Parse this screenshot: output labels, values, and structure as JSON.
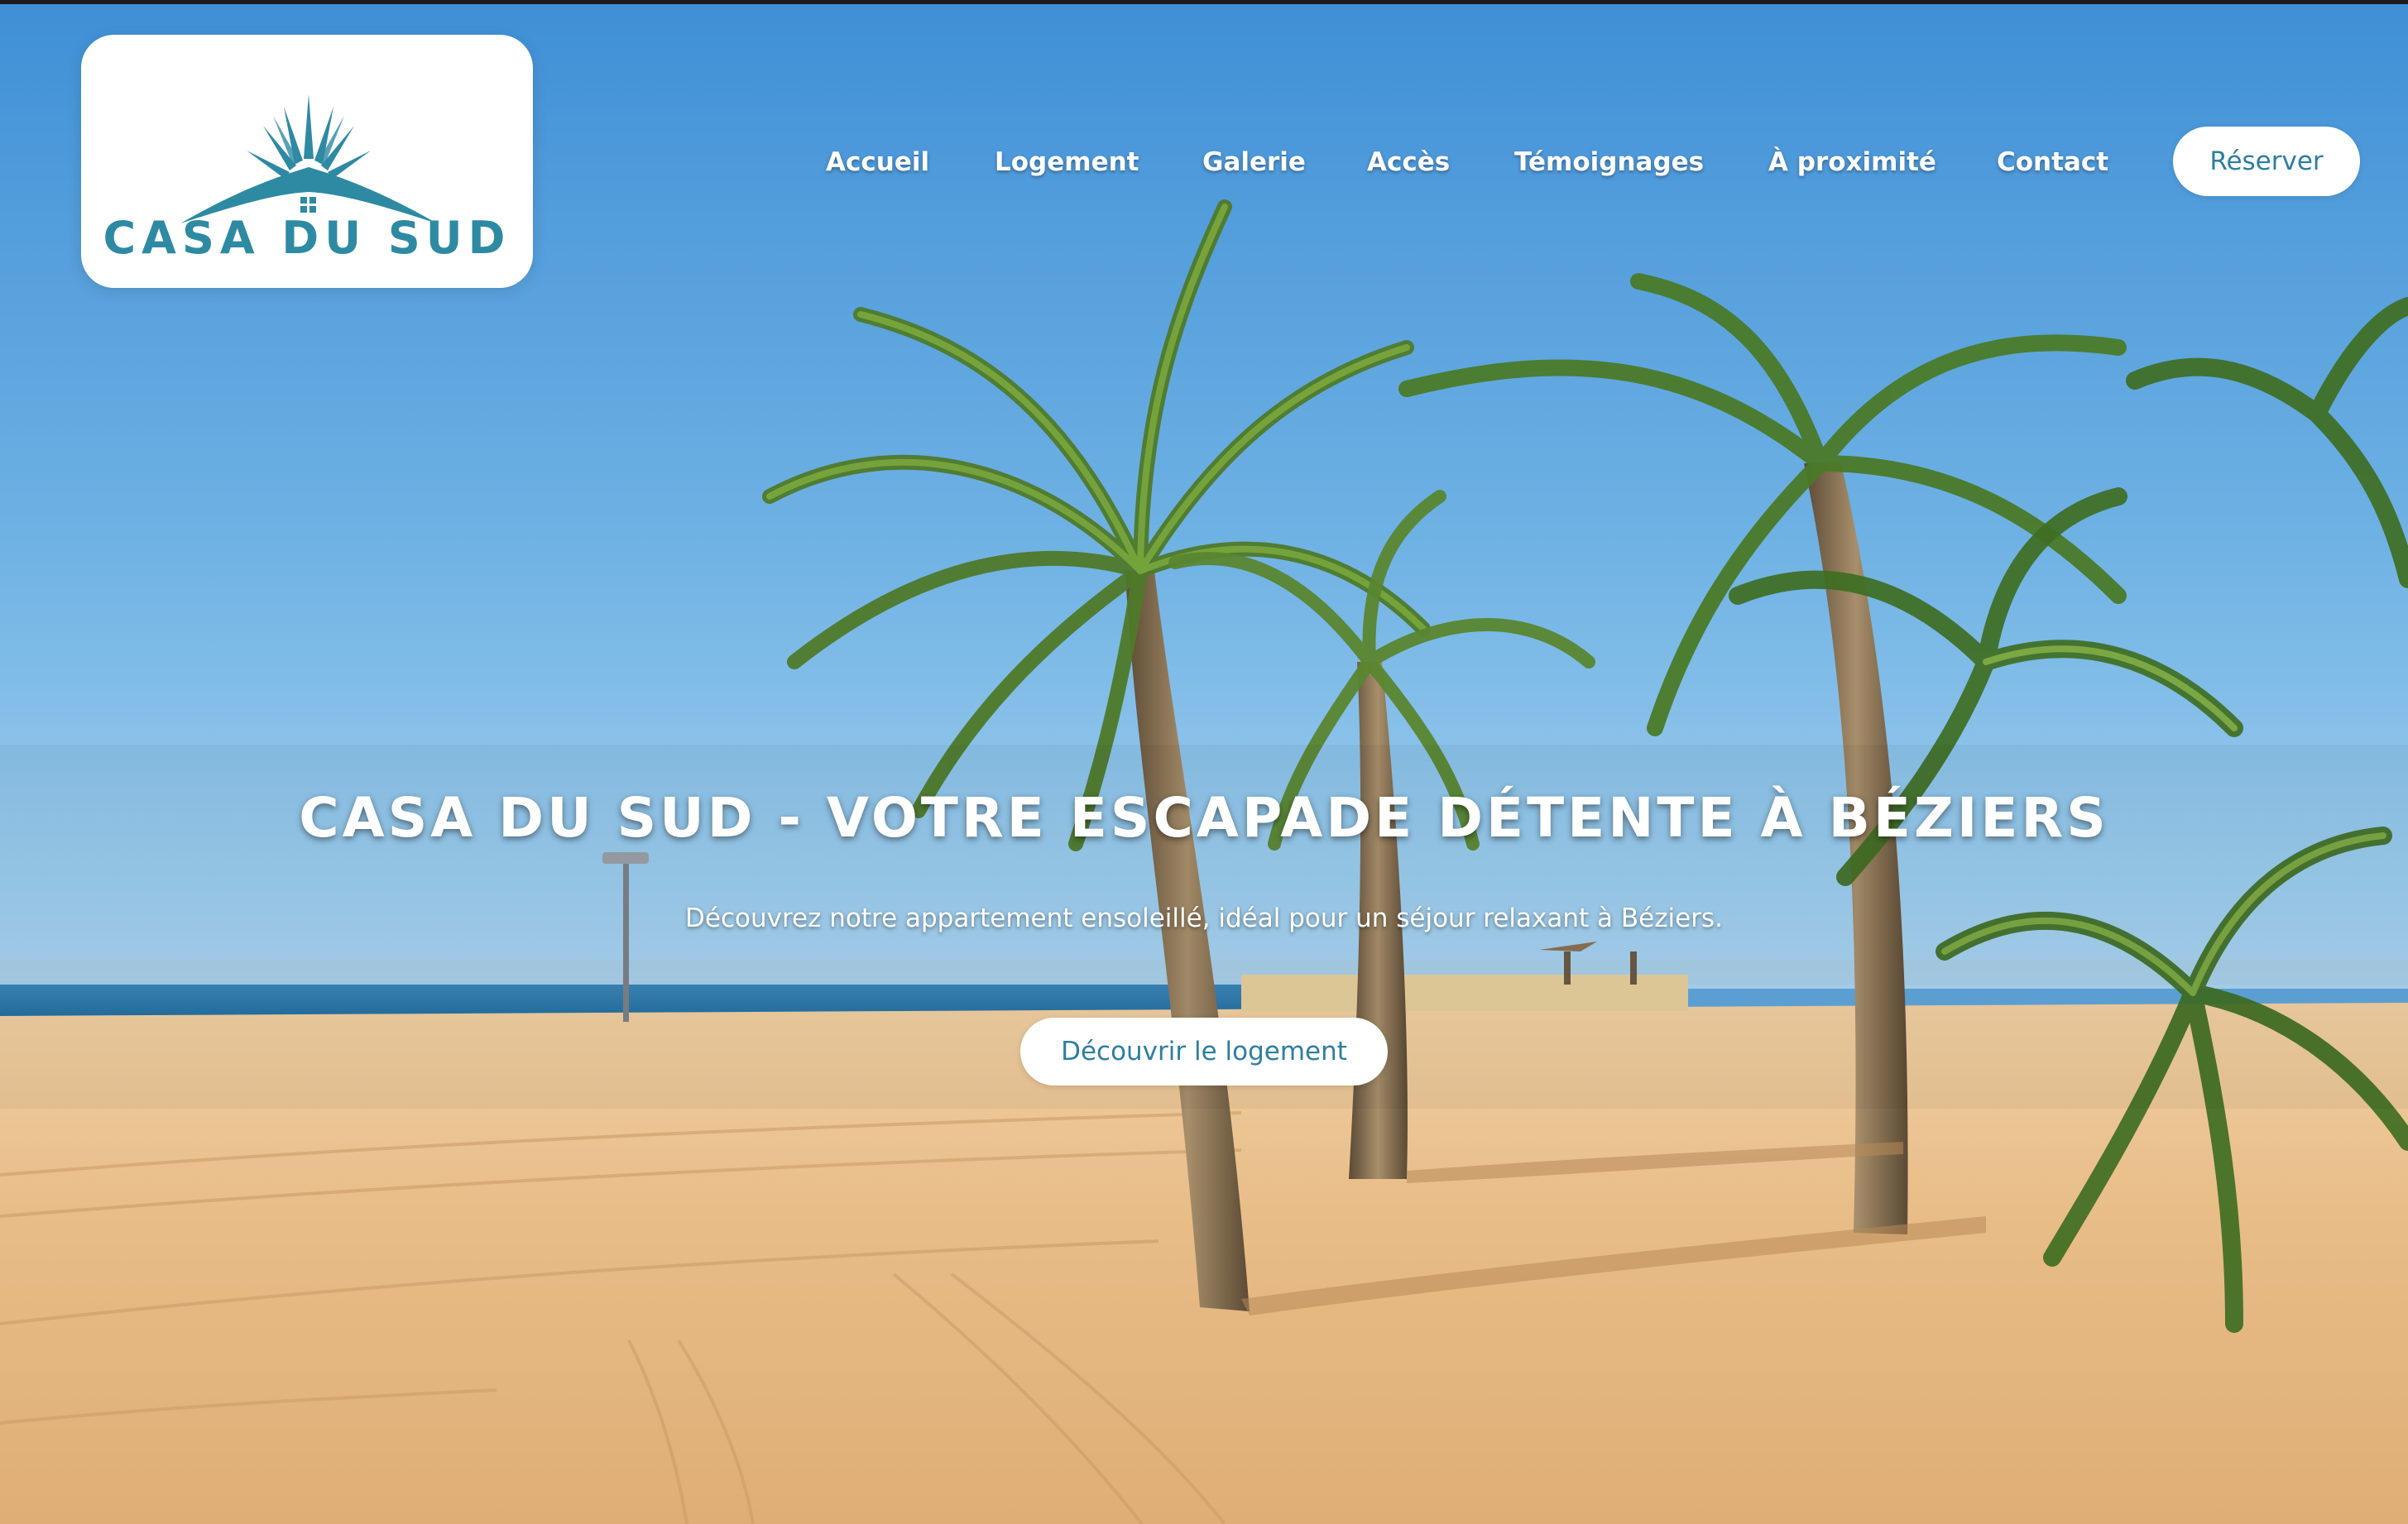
{
  "logo": {
    "text": "CASA DU SUD",
    "color": "#2e8aa3",
    "icon": "sun-house-logo-icon"
  },
  "nav": {
    "items": [
      {
        "label": "Accueil"
      },
      {
        "label": "Logement"
      },
      {
        "label": "Galerie"
      },
      {
        "label": "Accès"
      },
      {
        "label": "Témoignages"
      },
      {
        "label": "À proximité"
      },
      {
        "label": "Contact"
      }
    ],
    "reserve_label": "Réserver"
  },
  "hero": {
    "title": "CASA DU SUD - VOTRE ESCAPADE DÉTENTE À BÉZIERS",
    "subtitle": "Découvrez notre appartement ensoleillé, idéal pour un séjour relaxant à Béziers.",
    "cta_label": "Découvrir le logement",
    "background": "beach-with-palm-trees-image"
  },
  "colors": {
    "accent": "#2e7ea0",
    "sky": "#5fa6db",
    "sand": "#e8c08e",
    "sea": "#2f7fb0"
  }
}
